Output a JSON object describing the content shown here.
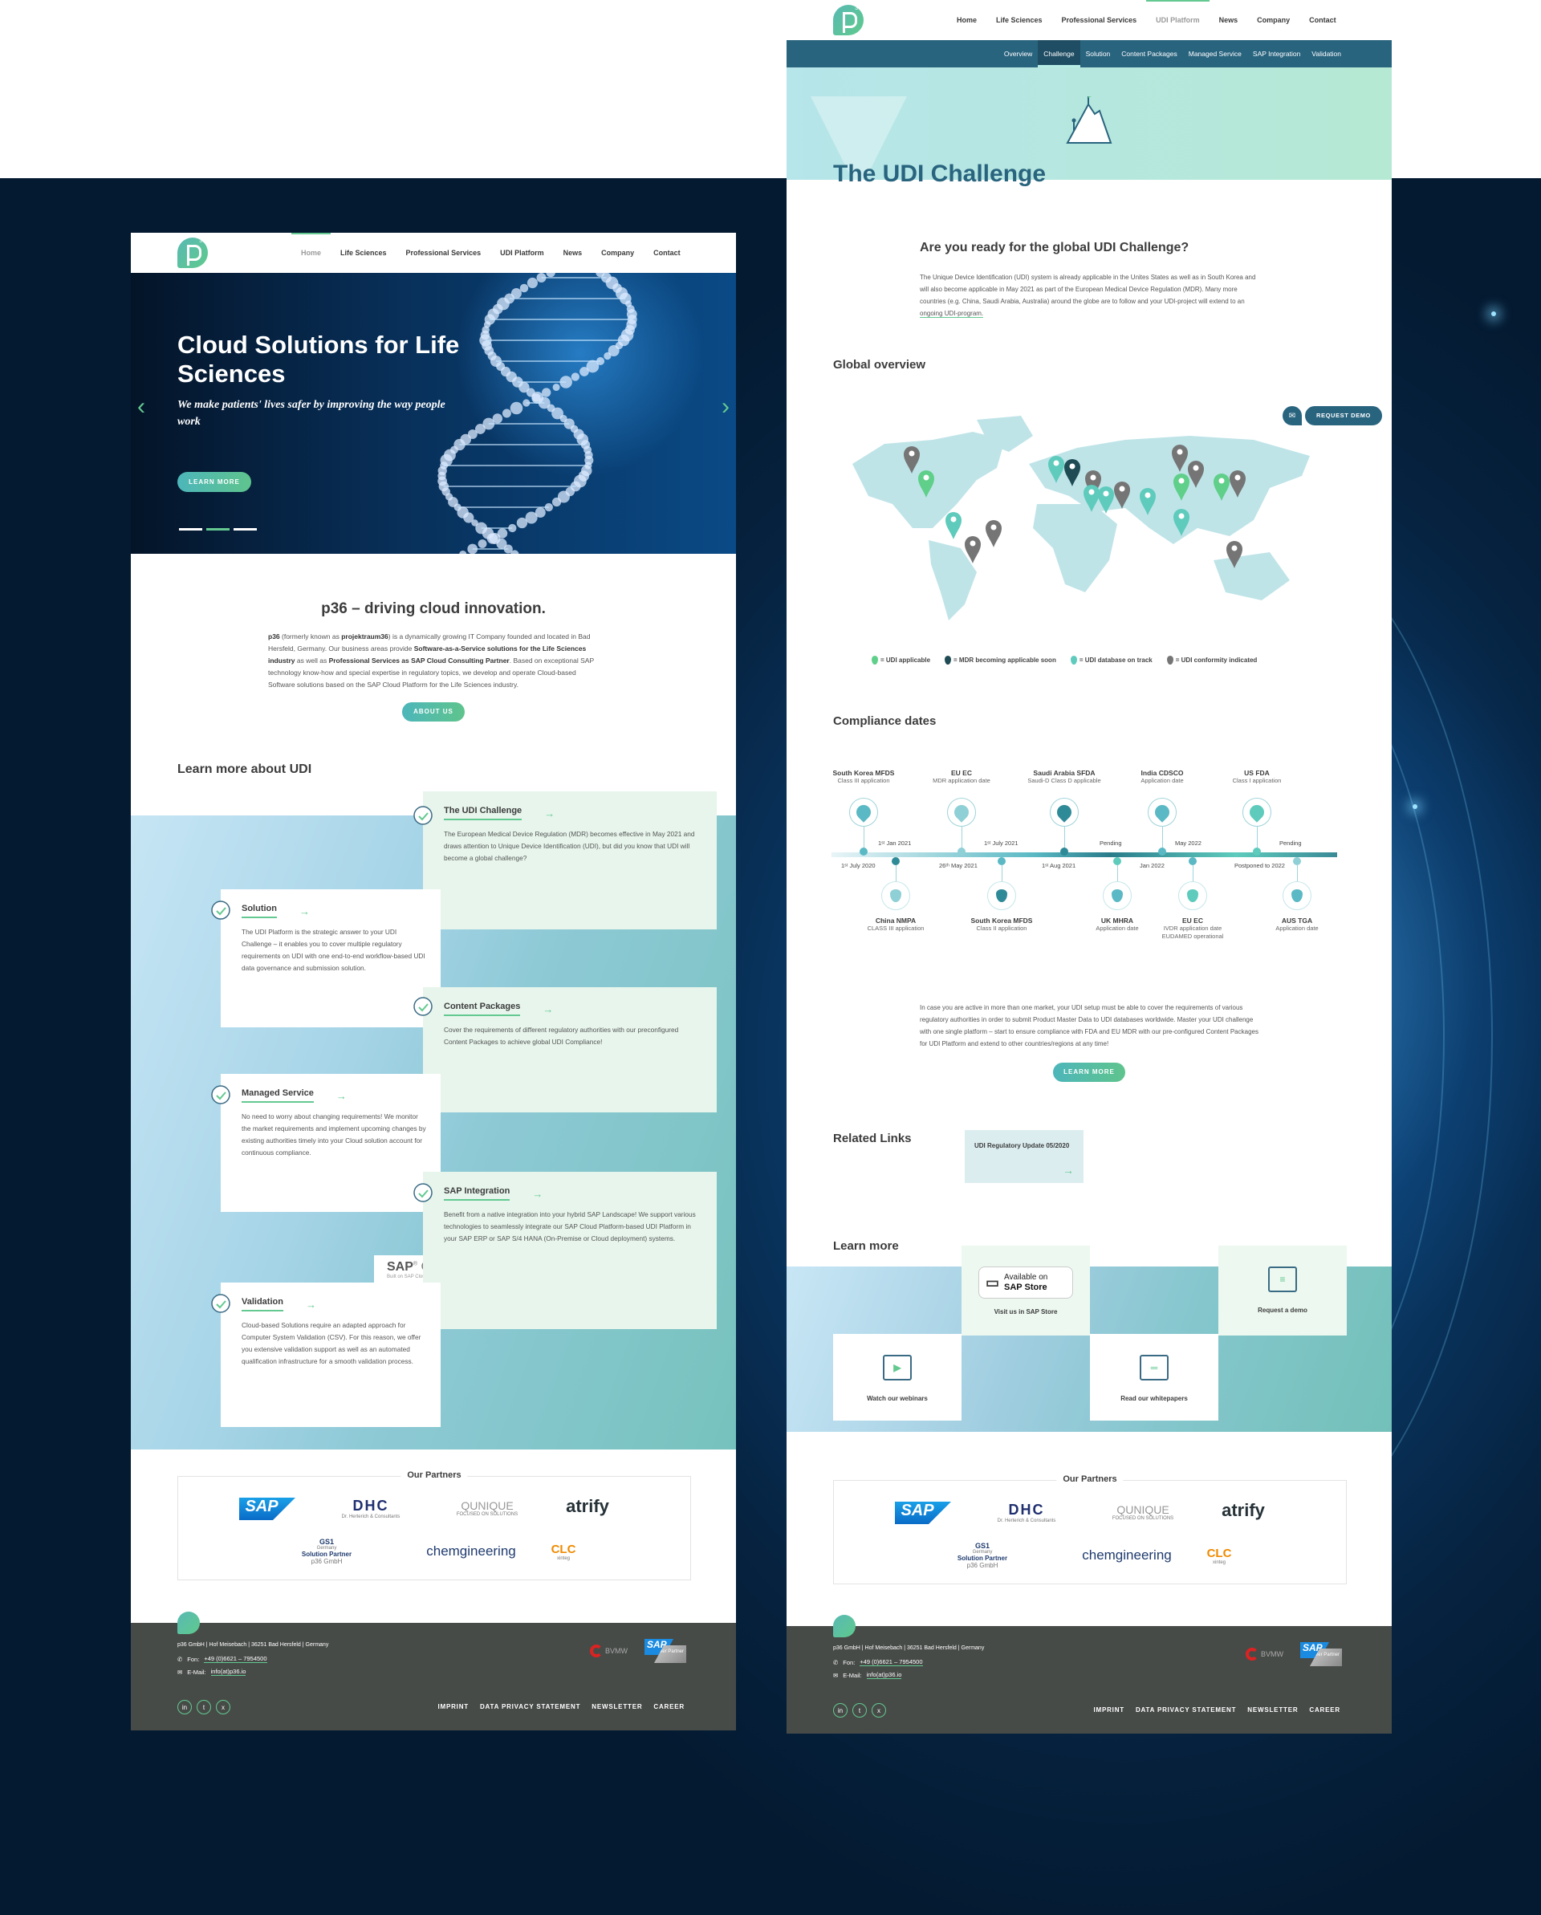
{
  "home_page": {
    "nav": {
      "logo_superscript": "36",
      "items": [
        {
          "label": "Home",
          "active": true
        },
        {
          "label": "Life Sciences",
          "active": false
        },
        {
          "label": "Professional Services",
          "active": false
        },
        {
          "label": "UDI Platform",
          "active": false
        },
        {
          "label": "News",
          "active": false
        },
        {
          "label": "Company",
          "active": false
        },
        {
          "label": "Contact",
          "active": false
        }
      ]
    },
    "hero": {
      "title": "Cloud Solutions for Life Sciences",
      "subtitle": "We make patients' lives safer by improving the way people work",
      "cta": "LEARN MORE",
      "prev_icon": "‹",
      "next_icon": "›",
      "slide_count": 3,
      "active_slide": 2
    },
    "intro": {
      "title": "p36 – driving cloud innovation.",
      "text_parts": [
        {
          "b": "p36"
        },
        {
          "t": " (formerly known as "
        },
        {
          "b": "projektraum36"
        },
        {
          "t": ") is a dynamically growing IT Company founded and located in Bad Hersfeld, Germany. Our business areas provide "
        },
        {
          "b": "Software-as-a-Service solutions for the Life Sciences industry"
        },
        {
          "t": " as well as "
        },
        {
          "b": "Professional Services as SAP Cloud Consulting Partner"
        },
        {
          "t": ". Based on exceptional SAP technology know-how and special expertise in regulatory topics, we develop and operate Cloud-based Software solutions based on the SAP Cloud Platform for the Life Sciences industry."
        }
      ],
      "cta": "ABOUT US"
    },
    "learn_more_title": "Learn more about UDI",
    "cards": [
      {
        "title": "The UDI Challenge",
        "icon": "mountain-flag-icon",
        "arrow": "→",
        "text": "The European Medical Device Regulation (MDR) becomes effective in May 2021 and draws attention to Unique Device Identification (UDI), but did you know that UDI will become a global challenge?"
      },
      {
        "title": "Solution",
        "icon": "lightbulb-icon",
        "arrow": "→",
        "text": "The UDI Platform is the strategic answer to your UDI Challenge – it enables you to cover multiple regulatory requirements on UDI with one end-to-end workflow-based UDI data governance and submission solution."
      },
      {
        "title": "Content Packages",
        "icon": "globe-icon",
        "arrow": "→",
        "text": "Cover the requirements of different regulatory authorities with our preconfigured Content Packages to achieve global UDI Compliance!"
      },
      {
        "title": "Managed Service",
        "icon": "hand-document-icon",
        "arrow": "→",
        "text": "No need to worry about changing requirements! We monitor the market requirements and implement upcoming changes by existing authorities timely into your Cloud solution account for continuous compliance."
      },
      {
        "title": "SAP Integration",
        "icon": "link-rings-icon",
        "arrow": "→",
        "text": "Benefit from a native integration into your hybrid SAP Landscape! We support various technologies to seamlessly integrate our SAP Cloud Platform-based UDI Platform in your SAP ERP or SAP S/4 HANA (On-Premise or Cloud deployment) systems."
      },
      {
        "title": "Validation",
        "icon": "document-check-icon",
        "arrow": "→",
        "text": "Cloud-based Solutions require an adapted approach for Computer System Validation (CSV). For this reason, we offer you extensive validation support as well as an automated qualification infrastructure for a smooth validation process."
      }
    ],
    "sap_certified": {
      "brand": "SAP",
      "reg": "®",
      "word": "Certified",
      "sub": "Built on SAP Cloud Platform"
    }
  },
  "partners": {
    "title": "Our Partners",
    "logos": [
      {
        "name": "SAP",
        "text": "SAP"
      },
      {
        "name": "DHC",
        "text": "DHC",
        "sub": "Dr. Herterich & Consultants"
      },
      {
        "name": "QUNIQUE",
        "text": "QUNIQUE",
        "sub": "FOCUSED ON SOLUTIONS"
      },
      {
        "name": "atrify",
        "text": "atrify"
      },
      {
        "name": "GS1",
        "text": "GS1",
        "sub": "Germany",
        "partner_title": "Solution Partner",
        "partner_sub": "p36 GmbH"
      },
      {
        "name": "chemgineering",
        "text": "chemgineering"
      },
      {
        "name": "CLC xinteg",
        "text": "CLC",
        "sub": "xinteg"
      }
    ]
  },
  "footer": {
    "address": "p36 GmbH | Hof Meisebach | 36251 Bad Hersfeld | Germany",
    "phone_label": "Fon:",
    "phone": "+49 (0)6621 – 7954500",
    "email_label": "E-Mail:",
    "email": "info(at)p36.io",
    "links": [
      "IMPRINT",
      "DATA PRIVACY STATEMENT",
      "NEWSLETTER",
      "CAREER"
    ],
    "social": [
      {
        "name": "linkedin",
        "glyph": "in"
      },
      {
        "name": "twitter",
        "glyph": "t"
      },
      {
        "name": "xing",
        "glyph": "x"
      }
    ],
    "badges": {
      "bvmw": "BVMW",
      "sap": "SAP",
      "sap_sub": "Silver Partner"
    }
  },
  "udi_page": {
    "nav": {
      "items": [
        {
          "label": "Home",
          "active": false
        },
        {
          "label": "Life Sciences",
          "active": false
        },
        {
          "label": "Professional Services",
          "active": false
        },
        {
          "label": "UDI Platform",
          "active": true
        },
        {
          "label": "News",
          "active": false
        },
        {
          "label": "Company",
          "active": false
        },
        {
          "label": "Contact",
          "active": false
        }
      ]
    },
    "subnav": [
      {
        "label": "Overview",
        "active": false
      },
      {
        "label": "Challenge",
        "active": true
      },
      {
        "label": "Solution",
        "active": false
      },
      {
        "label": "Content Packages",
        "active": false
      },
      {
        "label": "Managed Service",
        "active": false
      },
      {
        "label": "SAP Integration",
        "active": false
      },
      {
        "label": "Validation",
        "active": false
      }
    ],
    "title": "The UDI Challenge",
    "question": "Are you ready for the global UDI Challenge?",
    "intro_text": "The Unique Device Identification (UDI) system is already applicable in the Unites States as well as in South Korea and will also become applicable in May 2021 as part of the European Medical Device Regulation (MDR). Many more countries (e.g. China, Saudi Arabia, Australia) around the globe are to follow and your UDI-project will extend to an ",
    "intro_link": "ongoing UDI-program.",
    "global_overview_title": "Global overview",
    "request_demo": "REQUEST DEMO",
    "legend": [
      {
        "label": "= UDI applicable",
        "color": "#5fcf8a"
      },
      {
        "label": "= MDR becoming applicable soon",
        "color": "#1f4b55"
      },
      {
        "label": "= UDI database on track",
        "color": "#5ecbbd"
      },
      {
        "label": "= UDI conformity indicated",
        "color": "#757575"
      }
    ],
    "map_pins": [
      {
        "region": "Canada",
        "status": "conformity"
      },
      {
        "region": "USA",
        "status": "applicable"
      },
      {
        "region": "Central America",
        "status": "database"
      },
      {
        "region": "Brazil",
        "status": "conformity"
      },
      {
        "region": "Argentina",
        "status": "conformity"
      },
      {
        "region": "UK",
        "status": "database"
      },
      {
        "region": "EU",
        "status": "mdr"
      },
      {
        "region": "Turkey",
        "status": "conformity"
      },
      {
        "region": "Egypt",
        "status": "database"
      },
      {
        "region": "Saudi Arabia",
        "status": "database"
      },
      {
        "region": "Iran",
        "status": "conformity"
      },
      {
        "region": "India",
        "status": "database"
      },
      {
        "region": "Kazakhstan",
        "status": "conformity"
      },
      {
        "region": "China North",
        "status": "conformity"
      },
      {
        "region": "China",
        "status": "applicable"
      },
      {
        "region": "South Korea",
        "status": "applicable"
      },
      {
        "region": "Japan",
        "status": "conformity"
      },
      {
        "region": "Southeast Asia",
        "status": "database"
      },
      {
        "region": "Australia",
        "status": "conformity"
      }
    ],
    "compliance_title": "Compliance dates",
    "timeline_top": [
      {
        "name": "South Korea MFDS",
        "desc": "Class III application",
        "date": "1ˢᵗ July 2020",
        "icon": "pin-icon"
      },
      {
        "name": "EU EC",
        "desc": "MDR application date",
        "date": "26ᵗʰ May 2021",
        "icon": "pin-icon"
      },
      {
        "name": "Saudi Arabia SFDA",
        "desc": "Saudi-D Class D applicable",
        "date": "1ˢᵗ Aug 2021",
        "icon": "pin-icon"
      },
      {
        "name": "India CDSCO",
        "desc": "Application date",
        "date": "Jan 2022",
        "icon": "pin-icon"
      },
      {
        "name": "US FDA",
        "desc": "Class I application",
        "date": "Postponed to 2022",
        "icon": "clock-icon"
      }
    ],
    "timeline_bottom": [
      {
        "name": "China NMPA",
        "desc": "CLASS III application",
        "date": "1ˢᵗ Jan 2021",
        "icon": "drop-icon"
      },
      {
        "name": "South Korea MFDS",
        "desc": "Class II application",
        "date": "1ˢᵗ July 2021",
        "icon": "drop-icon"
      },
      {
        "name": "UK MHRA",
        "desc": "Application date",
        "date": "Pending",
        "icon": "clock-icon"
      },
      {
        "name": "EU EC",
        "desc": "IVDR application date\nEUDAMED operational",
        "date": "May 2022",
        "icon": "drop-icon"
      },
      {
        "name": "AUS TGA",
        "desc": "Application date",
        "date": "Pending",
        "icon": "clock-icon"
      }
    ],
    "para2": "In case you are active in more than one market, your UDI setup must be able to cover the requirements of various regulatory authorities in order to submit Product Master Data to UDI databases worldwide. Master your UDI challenge with one single platform – start to ensure compliance with FDA and EU MDR with our pre-configured Content Packages for UDI Platform and extend to other countries/regions at any time!",
    "learn_more_cta": "LEARN MORE",
    "related_title": "Related Links",
    "related": [
      {
        "title": "UDI Regulatory Update 05/2020",
        "arrow": "→"
      }
    ],
    "learn_more_title": "Learn more",
    "tiles": [
      {
        "label": "Visit us in SAP Store",
        "badge_line1": "Available on",
        "badge_line2": "SAP Store",
        "icon": "wallet-icon"
      },
      {
        "label": "Request a demo",
        "icon": "chat-bubbles-icon"
      },
      {
        "label": "Watch our webinars",
        "icon": "video-play-icon"
      },
      {
        "label": "Read our whitepapers",
        "icon": "book-icon"
      }
    ]
  }
}
